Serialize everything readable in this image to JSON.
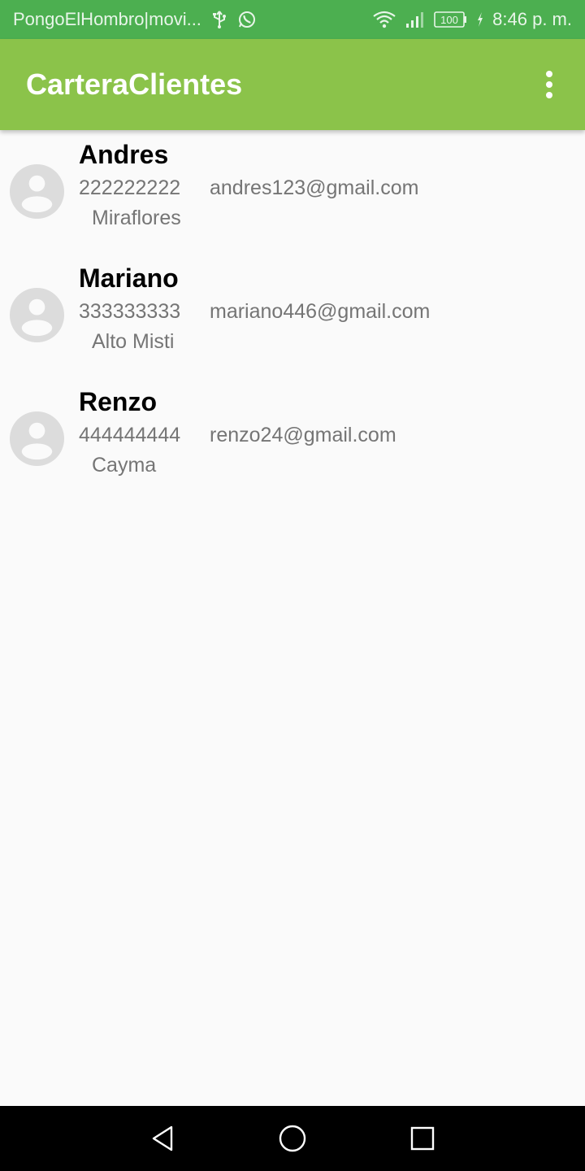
{
  "status_bar": {
    "notification_text": "PongoElHombro|movi...",
    "icons_left": [
      "usb-icon",
      "whatsapp-icon"
    ],
    "icons_right": [
      "wifi-icon",
      "signal-icon",
      "battery-icon",
      "charging-icon"
    ],
    "battery": "100",
    "time": "8:46 p. m."
  },
  "app_bar": {
    "title": "CarteraClientes",
    "menu_icon": "overflow-menu-icon",
    "background_color": "#8bc34a"
  },
  "clients": [
    {
      "name": "Andres",
      "phone": "222222222",
      "email": "andres123@gmail.com",
      "district": "Miraflores"
    },
    {
      "name": "Mariano",
      "phone": "333333333",
      "email": "mariano446@gmail.com",
      "district": "Alto Misti"
    },
    {
      "name": "Renzo",
      "phone": "444444444",
      "email": "renzo24@gmail.com",
      "district": "Cayma"
    }
  ],
  "nav_bar": {
    "buttons": [
      "back-icon",
      "home-icon",
      "recents-icon"
    ]
  },
  "colors": {
    "status_bar": "#4caf50",
    "app_bar": "#8bc34a",
    "secondary_text": "#757575",
    "avatar": "#dcdcdc"
  }
}
